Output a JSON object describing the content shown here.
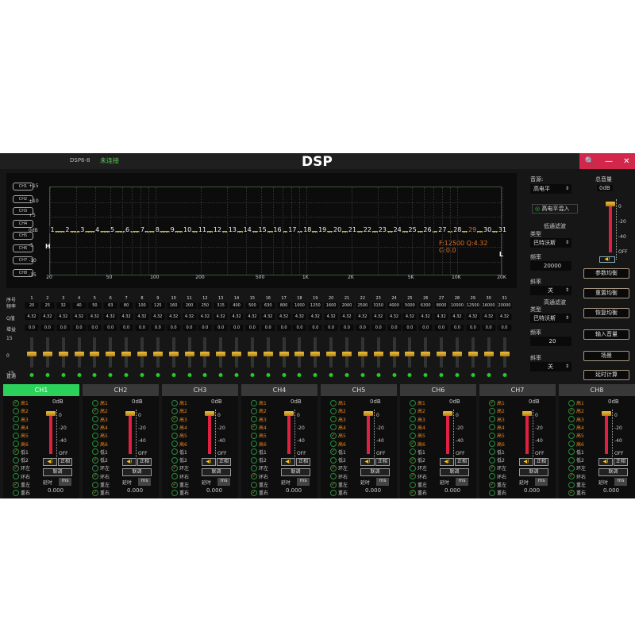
{
  "titlebar": {
    "model": "DSP6-8",
    "status": "未连接",
    "title": "DSP",
    "controls": [
      "🔍",
      "—",
      "✕"
    ]
  },
  "graph": {
    "channels": [
      "CH1",
      "CH2",
      "CH3",
      "CH4",
      "CH5",
      "CH6",
      "CH7",
      "CH8"
    ],
    "y_ticks": [
      "+15",
      "+10",
      "+5",
      "0dB",
      "-5",
      "-10",
      "-15"
    ],
    "x_ticks": [
      {
        "label": "20",
        "f": 20
      },
      {
        "label": "50",
        "f": 50
      },
      {
        "label": "100",
        "f": 100
      },
      {
        "label": "200",
        "f": 200
      },
      {
        "label": "500",
        "f": 500
      },
      {
        "label": "1K",
        "f": 1000
      },
      {
        "label": "2K",
        "f": 2000
      },
      {
        "label": "5K",
        "f": 5000
      },
      {
        "label": "10K",
        "f": 10000
      },
      {
        "label": "20K",
        "f": 20000
      }
    ],
    "selected_point": 29,
    "readout": "F:12500 Q:4.32 G:0.0",
    "h_marker": "H",
    "l_marker": "L"
  },
  "eq": {
    "row_labels": {
      "index": "序号",
      "freq": "频率",
      "q": "Q值",
      "gain": "增益",
      "bypass": "直通"
    },
    "scale": [
      "15",
      "0",
      "-15"
    ],
    "freqs": [
      "20",
      "25",
      "32",
      "40",
      "50",
      "63",
      "80",
      "100",
      "125",
      "160",
      "200",
      "250",
      "315",
      "400",
      "500",
      "630",
      "800",
      "1000",
      "1250",
      "1600",
      "2000",
      "2500",
      "3150",
      "4000",
      "5000",
      "6300",
      "8000",
      "10000",
      "12500",
      "16000",
      "20000"
    ],
    "q": "4.32",
    "gain": "0.0",
    "gain_db": 0
  },
  "right": {
    "source_label": "音源:",
    "source": "高电平",
    "mix": "高电平混入",
    "lpf_title": "低通滤波",
    "type_label": "类型",
    "lpf_type": "巴特沃斯",
    "freq_label": "频率",
    "lpf_freq": "20000",
    "slope_label": "斜率",
    "lpf_slope": "关",
    "hpf_title": "高通滤波",
    "hpf_type": "巴特沃斯",
    "hpf_freq": "20",
    "hpf_slope": "关",
    "master_label": "总音量",
    "master_value": "0dB",
    "master_scale": [
      "0",
      "-20",
      "-40",
      "OFF"
    ],
    "buttons": [
      "参数均衡",
      "重置均衡",
      "恢复均衡",
      "输入音量",
      "场景",
      "延时计算"
    ]
  },
  "strips": {
    "routes": [
      "高1",
      "高2",
      "高3",
      "高4",
      "高5",
      "高6",
      "低1",
      "低2",
      "环左",
      "环右",
      "重左",
      "重右"
    ],
    "scale": [
      "0",
      "-20",
      "-40",
      "OFF"
    ],
    "phase": "正相",
    "link": "联调",
    "delay_label": "延时",
    "delay_unit": "ms",
    "channels": [
      {
        "name": "CH1",
        "gain": "0dB",
        "delay": "0.000",
        "checked": [
          0,
          6,
          8,
          10
        ],
        "active": true
      },
      {
        "name": "CH2",
        "gain": "0dB",
        "delay": "0.000",
        "checked": [
          1,
          7,
          9,
          11
        ]
      },
      {
        "name": "CH3",
        "gain": "0dB",
        "delay": "0.000",
        "checked": [
          2,
          8,
          10
        ]
      },
      {
        "name": "CH4",
        "gain": "0dB",
        "delay": "0.000",
        "checked": [
          3,
          9,
          11
        ]
      },
      {
        "name": "CH5",
        "gain": "0dB",
        "delay": "0.000",
        "checked": [
          4,
          6,
          8,
          10
        ]
      },
      {
        "name": "CH6",
        "gain": "0dB",
        "delay": "0.000",
        "checked": [
          5,
          7,
          9,
          11
        ]
      },
      {
        "name": "CH7",
        "gain": "0dB",
        "delay": "0.000",
        "checked": [
          0,
          8,
          10
        ]
      },
      {
        "name": "CH8",
        "gain": "0dB",
        "delay": "0.000",
        "checked": [
          1,
          9,
          11
        ]
      }
    ]
  },
  "colors": {
    "accent": "#2bd15a",
    "close": "#d2264a",
    "selected": "#e07020",
    "eqline": "#c8b43a"
  }
}
